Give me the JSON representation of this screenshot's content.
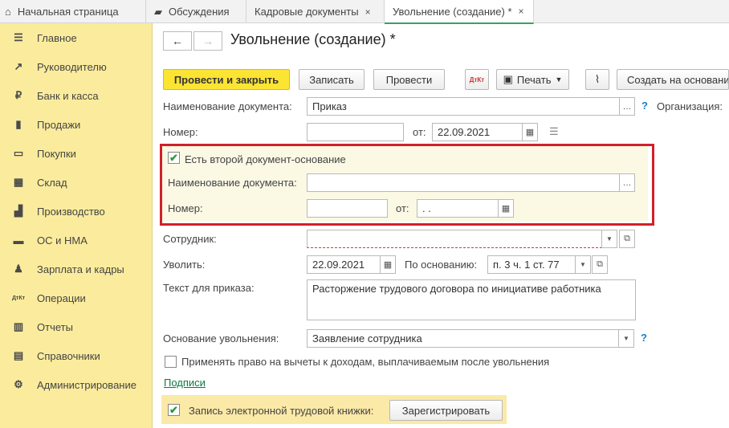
{
  "tabs": [
    {
      "label": "Начальная страница",
      "icon": "home-icon"
    },
    {
      "label": "Обсуждения",
      "icon": "chat-icon"
    },
    {
      "label": "Кадровые документы",
      "close": "×"
    },
    {
      "label": "Увольнение (создание) *",
      "close": "×"
    }
  ],
  "sidebar": {
    "items": [
      {
        "label": "Главное",
        "icon": "menu-icon",
        "glyph": "☰"
      },
      {
        "label": "Руководителю",
        "icon": "trend-icon",
        "glyph": "↗"
      },
      {
        "label": "Банк и касса",
        "icon": "coin-icon",
        "glyph": "₽"
      },
      {
        "label": "Продажи",
        "icon": "bag-icon",
        "glyph": "▮"
      },
      {
        "label": "Покупки",
        "icon": "cart-icon",
        "glyph": "▭"
      },
      {
        "label": "Склад",
        "icon": "warehouse-icon",
        "glyph": "▦"
      },
      {
        "label": "Производство",
        "icon": "factory-icon",
        "glyph": "▟"
      },
      {
        "label": "ОС и НМА",
        "icon": "truck-icon",
        "glyph": "▬"
      },
      {
        "label": "Зарплата и кадры",
        "icon": "person-icon",
        "glyph": "♟"
      },
      {
        "label": "Операции",
        "icon": "dt-kt-icon",
        "glyph": "ДтКт"
      },
      {
        "label": "Отчеты",
        "icon": "bar-chart-icon",
        "glyph": "▥"
      },
      {
        "label": "Справочники",
        "icon": "book-icon",
        "glyph": "▤"
      },
      {
        "label": "Администрирование",
        "icon": "gear-icon",
        "glyph": "⚙"
      }
    ]
  },
  "header": {
    "back": "←",
    "forward": "→",
    "title": "Увольнение (создание) *"
  },
  "toolbar": {
    "post_close": "Провести и закрыть",
    "save": "Записать",
    "post": "Провести",
    "dtkt": "ДтКт",
    "print": "Печать",
    "attach_icon": "paperclip-icon",
    "create_based": "Создать на основании"
  },
  "form": {
    "doc_name_label": "Наименование документа:",
    "doc_name_value": "Приказ",
    "org_label": "Организация:",
    "number_label": "Номер:",
    "number_value": "",
    "from_label": "от:",
    "date_value": "22.09.2021",
    "second_doc": {
      "checkbox_label": "Есть второй документ-основание",
      "checked": true,
      "doc_name_label": "Наименование документа:",
      "doc_name_value": "",
      "number_label": "Номер:",
      "number_value": "",
      "from_label": "от:",
      "date_value": " .  .  "
    },
    "employee_label": "Сотрудник:",
    "employee_value": "",
    "dismiss_label": "Уволить:",
    "dismiss_date": "22.09.2021",
    "basis_label": "По основанию:",
    "basis_value": "п. 3 ч. 1 ст. 77",
    "order_text_label": "Текст для приказа:",
    "order_text_value": "Расторжение трудового договора по инициативе работника",
    "reason_label": "Основание увольнения:",
    "reason_value": "Заявление сотрудника",
    "deduction_label": "Применять право на вычеты к доходам, выплачиваемым после увольнения",
    "signatures_link": "Подписи",
    "etk_label": "Запись электронной трудовой книжки:",
    "register_button": "Зарегистрировать"
  },
  "colors": {
    "accent": "#fce433",
    "sidebar": "#fbec9d",
    "highlight": "#d1202a",
    "link": "#0c7a3c"
  }
}
